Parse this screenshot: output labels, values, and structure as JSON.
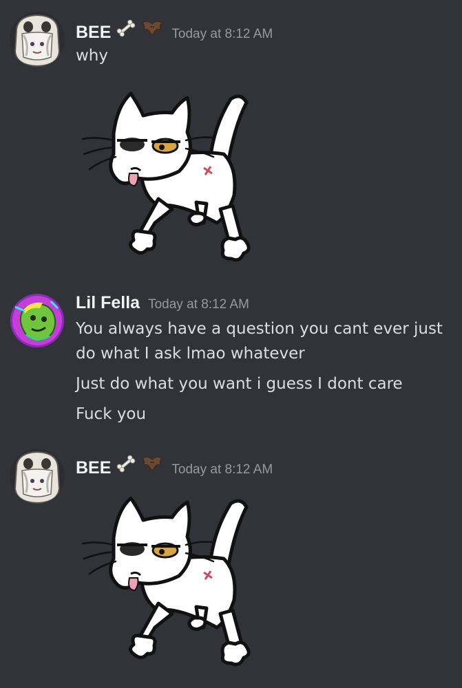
{
  "messages": [
    {
      "username": "BEE",
      "timestamp": "Today at 8:12 AM",
      "badges": [
        "bone-icon",
        "bat-icon"
      ],
      "avatar": "skull-mask-avatar",
      "lines": [
        "why"
      ],
      "sticker": "white-cat-sticker"
    },
    {
      "username": "Lil Fella",
      "timestamp": "Today at 8:12 AM",
      "avatar": "green-character-avatar",
      "lines": [
        "You always have a question you cant ever just",
        "do what I ask lmao whatever",
        "Just do what you want i guess I dont care",
        "Fuck you"
      ]
    },
    {
      "username": "BEE",
      "timestamp": "Today at 8:12 AM",
      "badges": [
        "bone-icon",
        "bat-icon"
      ],
      "avatar": "skull-mask-avatar",
      "sticker": "white-cat-sticker"
    }
  ],
  "colors": {
    "background": "#313338",
    "username": "#f2f3f5",
    "timestamp": "#949ba4",
    "text": "#dbdee1"
  }
}
